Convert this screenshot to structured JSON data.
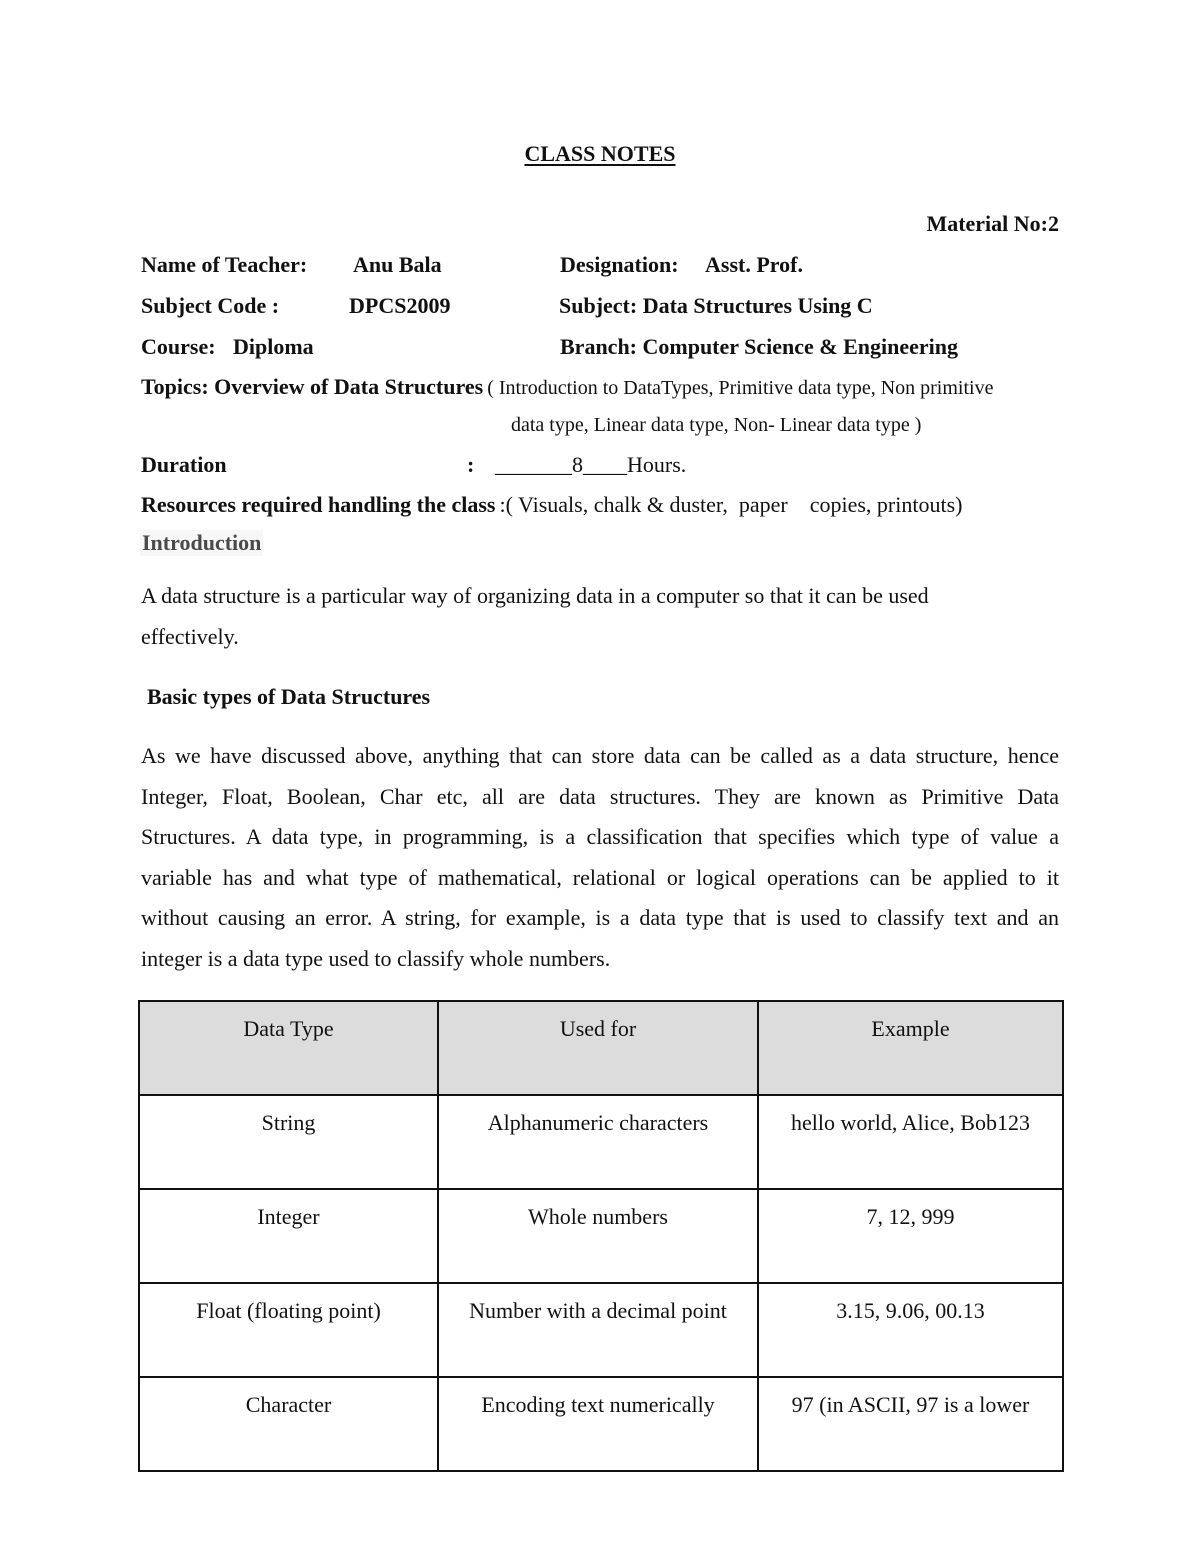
{
  "document": {
    "title": "CLASS NOTES",
    "material_no": "Material No:2",
    "teacher_label": "Name of Teacher:",
    "teacher_value": "Anu Bala",
    "designation_label": "Designation:",
    "designation_value": "Asst. Prof.",
    "subject_code_label": "Subject Code :",
    "subject_code_value": "DPCS2009",
    "subject_label": "Subject: Data Structures Using C",
    "course_label": "Course:",
    "course_value": "Diploma",
    "branch_label": "Branch: Computer Science & Engineering",
    "topics_label": "Topics: Overview of Data Structures",
    "topics_line1": "( Introduction to DataTypes, Primitive data type, Non primitive",
    "topics_line2": "data type, Linear data type, Non- Linear data type )",
    "duration_label": "Duration",
    "duration_colon": ":",
    "duration_value": "_______8____Hours.",
    "resources_label": "Resources required handling the class",
    "resources_value": ":( Visuals, chalk & duster,  paper    copies, printouts)",
    "intro_heading": "Introduction",
    "intro_lines": [
      "A data structure is a particular way of organizing data in a computer so that it can be used",
      "effectively."
    ],
    "basic_heading": "Basic types of Data Structures",
    "basic_lines": [
      "As we have discussed above, anything that can store data can be called as a data structure, hence",
      "Integer, Float, Boolean, Char etc, all are data structures. They are known as Primitive Data",
      "Structures. A data type, in programming, is a classification that specifies which type of value a",
      "variable has and what type of mathematical, relational or logical operations can be applied to it",
      "without causing an error. A string, for example, is a data type that is used to classify text and an",
      "integer is a data type used to classify whole numbers."
    ]
  },
  "table": {
    "headers": [
      "Data Type",
      "Used for",
      "Example"
    ],
    "rows": [
      [
        "String",
        "Alphanumeric characters",
        "hello world, Alice, Bob123"
      ],
      [
        "Integer",
        "Whole numbers",
        "7, 12, 999"
      ],
      [
        "Float (floating point)",
        "Number with a decimal point",
        "3.15, 9.06, 00.13"
      ],
      [
        "Character",
        "Encoding text numerically",
        "97 (in ASCII, 97 is a lower"
      ]
    ]
  }
}
